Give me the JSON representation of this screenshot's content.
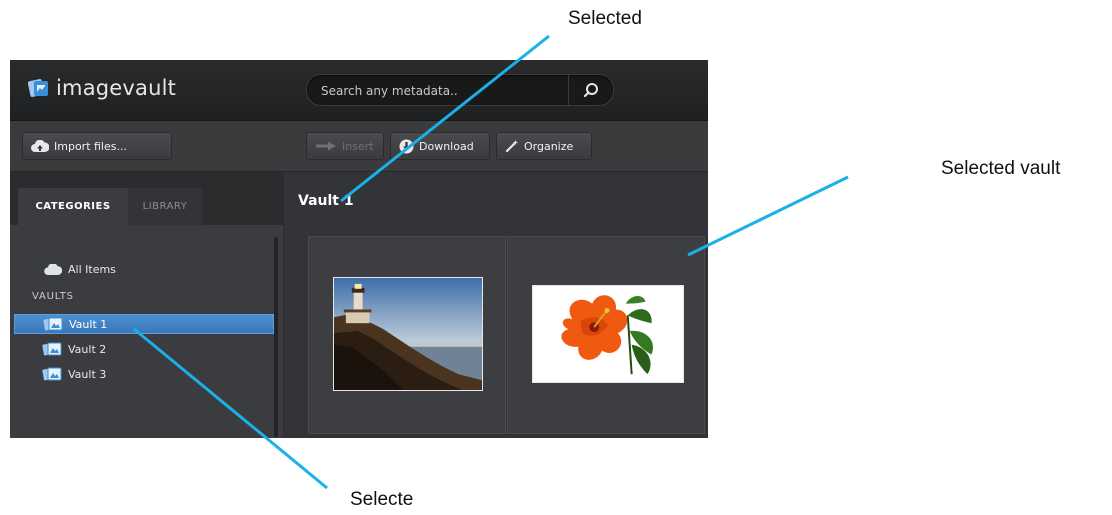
{
  "app": {
    "logo_text": "imagevault",
    "logo_icon": "imagevault-logo-icon"
  },
  "search": {
    "placeholder": "Search any metadata..",
    "icon": "search-icon"
  },
  "toolbar": {
    "import_label": "Import files...",
    "insert_label": "Insert",
    "download_label": "Download",
    "organize_label": "Organize",
    "insert_enabled": false
  },
  "sidebar": {
    "tabs": [
      {
        "label": "CATEGORIES",
        "active": true
      },
      {
        "label": "LIBRARY",
        "active": false
      }
    ],
    "all_items_label": "All Items",
    "vaults_heading": "VAULTS",
    "vaults": [
      {
        "label": "Vault 1",
        "selected": true
      },
      {
        "label": "Vault 2",
        "selected": false
      },
      {
        "label": "Vault 3",
        "selected": false
      }
    ]
  },
  "main": {
    "title": "Vault 1",
    "thumbnails": [
      {
        "subject": "lighthouse at sunset"
      },
      {
        "subject": "orange hibiscus flower"
      }
    ]
  },
  "annotations": {
    "top_label": "Selected",
    "right_label": "Selected vault",
    "bottom_label": "Selecte",
    "line_color": "#1ab0e8"
  },
  "colors": {
    "selection_blue": "#3a78b8",
    "app_background": "#2d2e30"
  }
}
